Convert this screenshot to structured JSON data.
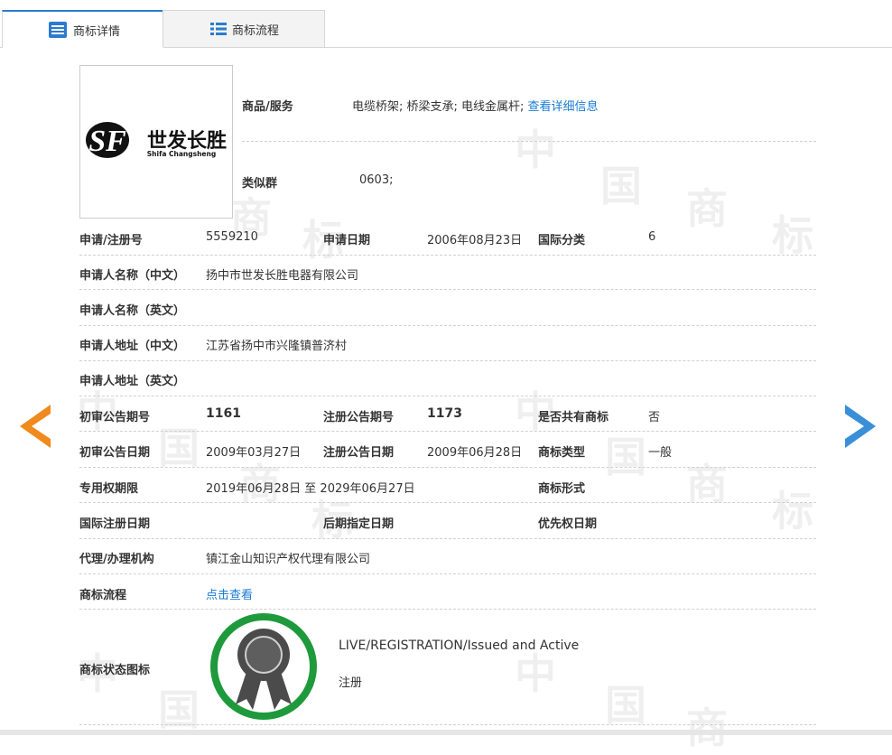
{
  "tabs": [
    {
      "label": "商标详情"
    },
    {
      "label": "商标流程"
    }
  ],
  "watermark": {
    "chars": [
      "中",
      "国",
      "商",
      "标"
    ]
  },
  "logo": {
    "brand_cn": "世发长胜",
    "brand_en": "Shifa Changsheng",
    "mark": "SF"
  },
  "goods": {
    "label": "商品/服务",
    "value": "电缆桥架; 桥梁支承; 电线金属杆;",
    "link": "查看详细信息"
  },
  "similar": {
    "label": "类似群",
    "value": "0603;"
  },
  "reg": {
    "no_label": "申请/注册号",
    "no": "5559210",
    "date_label": "申请日期",
    "date": "2006年08月23日",
    "intl_label": "国际分类",
    "intl": "6"
  },
  "applicant_cn": {
    "label": "申请人名称（中文）",
    "value": "扬中市世发长胜电器有限公司"
  },
  "applicant_en": {
    "label": "申请人名称（英文）",
    "value": ""
  },
  "address_cn": {
    "label": "申请人地址（中文）",
    "value": "江苏省扬中市兴隆镇普济村"
  },
  "address_en": {
    "label": "申请人地址（英文）",
    "value": ""
  },
  "prelim": {
    "issue_label": "初审公告期号",
    "issue": "1161",
    "reg_issue_label": "注册公告期号",
    "reg_issue": "1173",
    "shared_label": "是否共有商标",
    "shared": "否"
  },
  "prelim_date": {
    "label": "初审公告日期",
    "value": "2009年03月27日",
    "reg_label": "注册公告日期",
    "reg_value": "2009年06月28日",
    "type_label": "商标类型",
    "type_value": "一般"
  },
  "exclusive": {
    "label": "专用权期限",
    "value": "2019年06月28日 至 2029年06月27日",
    "form_label": "商标形式"
  },
  "intl_reg": {
    "label": "国际注册日期",
    "later_label": "后期指定日期",
    "priority_label": "优先权日期"
  },
  "agent": {
    "label": "代理/办理机构",
    "value": "镇江金山知识产权代理有限公司"
  },
  "flow": {
    "label": "商标流程",
    "link": "点击查看"
  },
  "status": {
    "label": "商标状态图标",
    "en": "LIVE/REGISTRATION/Issued and Active",
    "cn": "注册"
  },
  "colors": {
    "accent": "#2b7bd0",
    "link": "#1a7bd3",
    "prev_arrow": "#f08a1c",
    "next_arrow": "#3a8fd9",
    "badge_ring": "#1e9a3c"
  }
}
